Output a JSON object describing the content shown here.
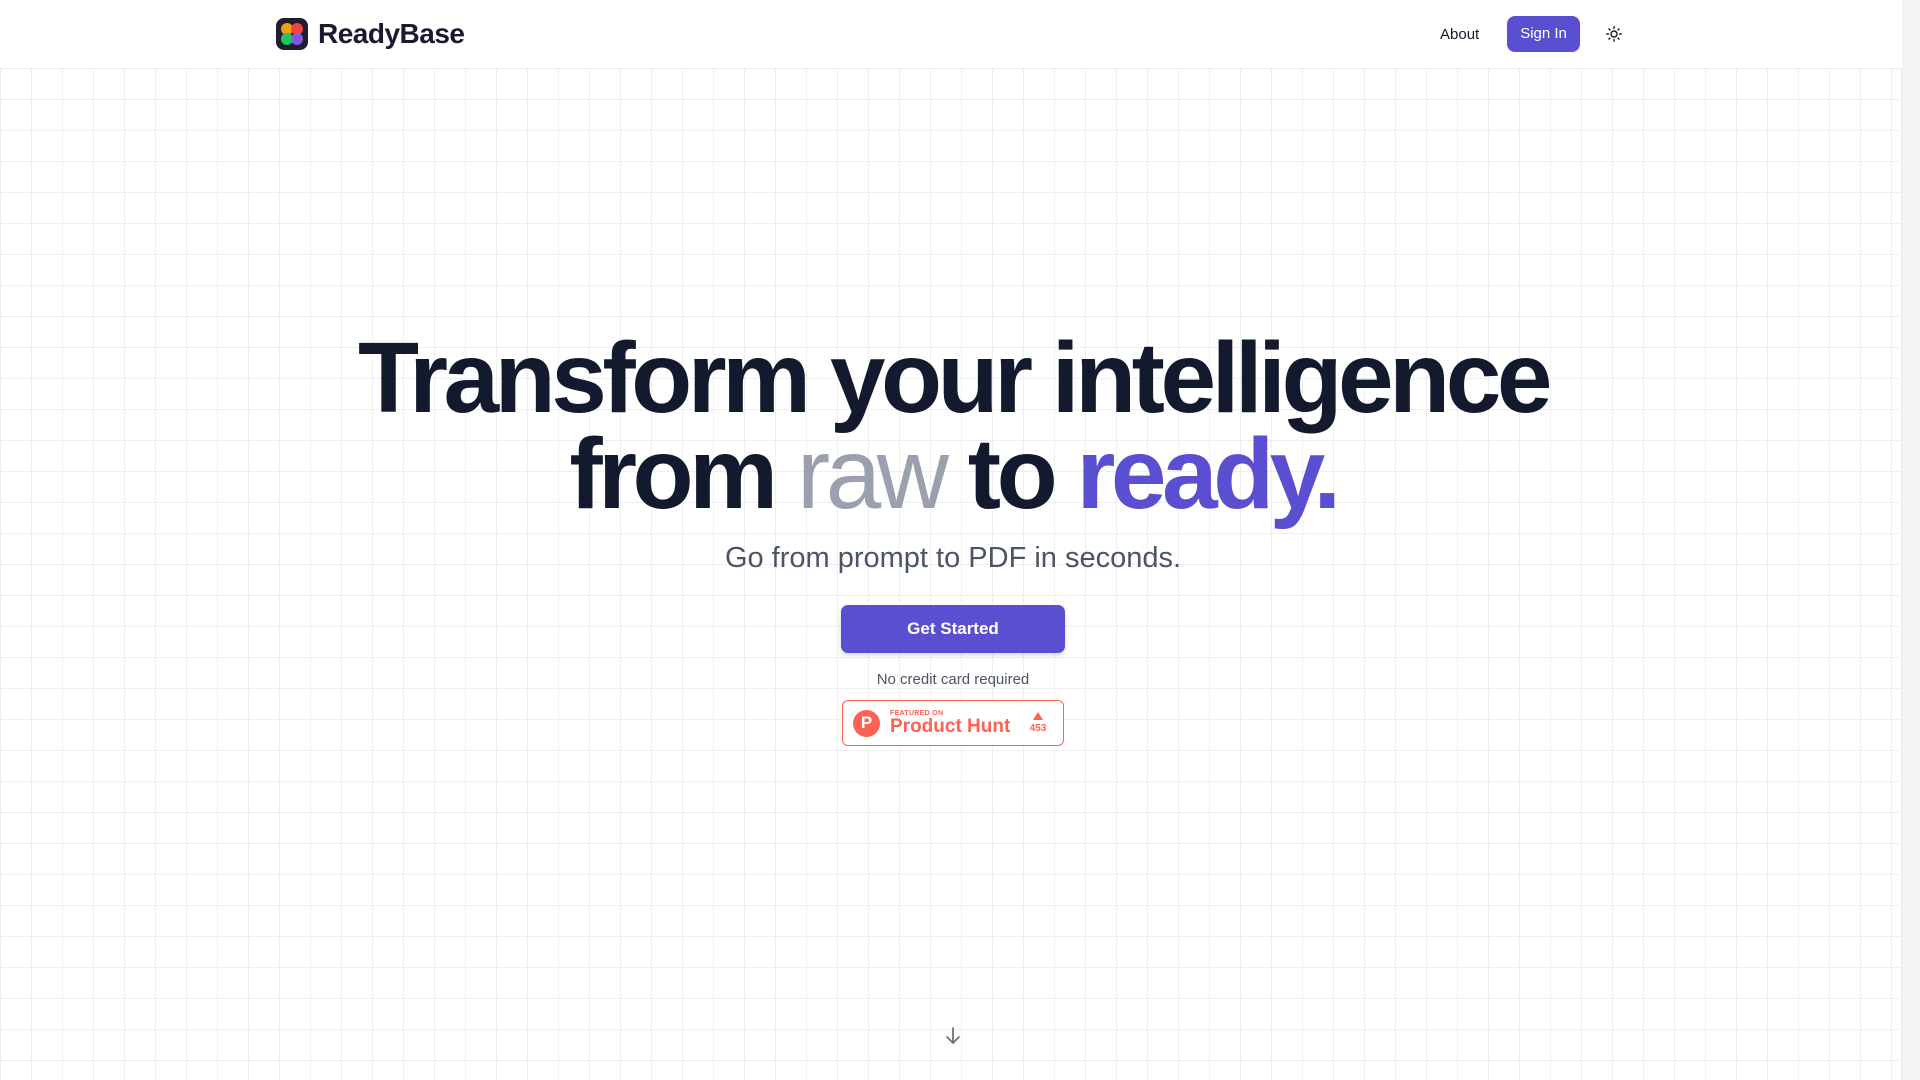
{
  "header": {
    "brand_name": "ReadyBase",
    "nav": {
      "about_label": "About",
      "signin_label": "Sign In"
    },
    "theme_toggle_icon": "sun-icon",
    "logo_icon": "four-petal-logo-icon"
  },
  "hero": {
    "line1": "Transform your intelligence",
    "line2_from": "from",
    "line2_raw": "raw",
    "line2_to": "to",
    "line2_ready": "ready.",
    "subhead": "Go from prompt to PDF in seconds.",
    "cta_label": "Get Started",
    "cta_note": "No credit card required"
  },
  "product_hunt": {
    "featured_label": "FEATURED ON",
    "name": "Product Hunt",
    "logo_letter": "P",
    "votes": "453"
  },
  "scroll_hint_icon": "arrow-down-icon",
  "colors": {
    "accent": "#5b4fd1",
    "heading": "#141a2e",
    "muted_word": "#9aa0ad",
    "product_hunt": "#ff6154",
    "logo_petals": [
      "#f59e0b",
      "#ef4444",
      "#22c55e",
      "#8b5cf6"
    ]
  }
}
